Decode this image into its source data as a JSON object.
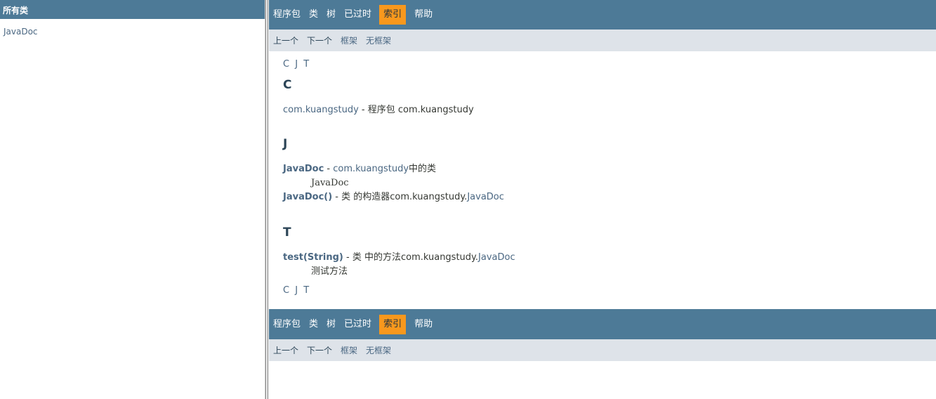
{
  "left": {
    "header": "所有类",
    "classes": [
      "JavaDoc"
    ]
  },
  "nav": {
    "items": [
      "程序包",
      "类",
      "树",
      "已过时",
      "索引",
      "帮助"
    ],
    "active": "索引"
  },
  "subnav": {
    "prev": "上一个",
    "next": "下一个",
    "frames": "框架",
    "noframes": "无框架"
  },
  "index": {
    "letters": [
      "C",
      "J",
      "T"
    ],
    "sections": {
      "C": {
        "heading": "C",
        "e1_link": "com.kuangstudy",
        "e1_rest": " - 程序包 com.kuangstudy"
      },
      "J": {
        "heading": "J",
        "e1_name": "JavaDoc",
        "e1_sep": " - ",
        "e1_link": "com.kuangstudy",
        "e1_rest": "中的类",
        "e1_desc": "JavaDoc",
        "e2_name": "JavaDoc()",
        "e2_rest": " - 类 的构造器com.kuangstudy.",
        "e2_link": "JavaDoc"
      },
      "T": {
        "heading": "T",
        "e1_name": "test(String)",
        "e1_rest": " - 类 中的方法com.kuangstudy.",
        "e1_link": "JavaDoc",
        "e1_desc": "测试方法"
      }
    }
  },
  "colors": {
    "navbar": "#4d7a97",
    "active_tab": "#f8981d",
    "subnav": "#dee3e9",
    "link": "#4a6782"
  }
}
